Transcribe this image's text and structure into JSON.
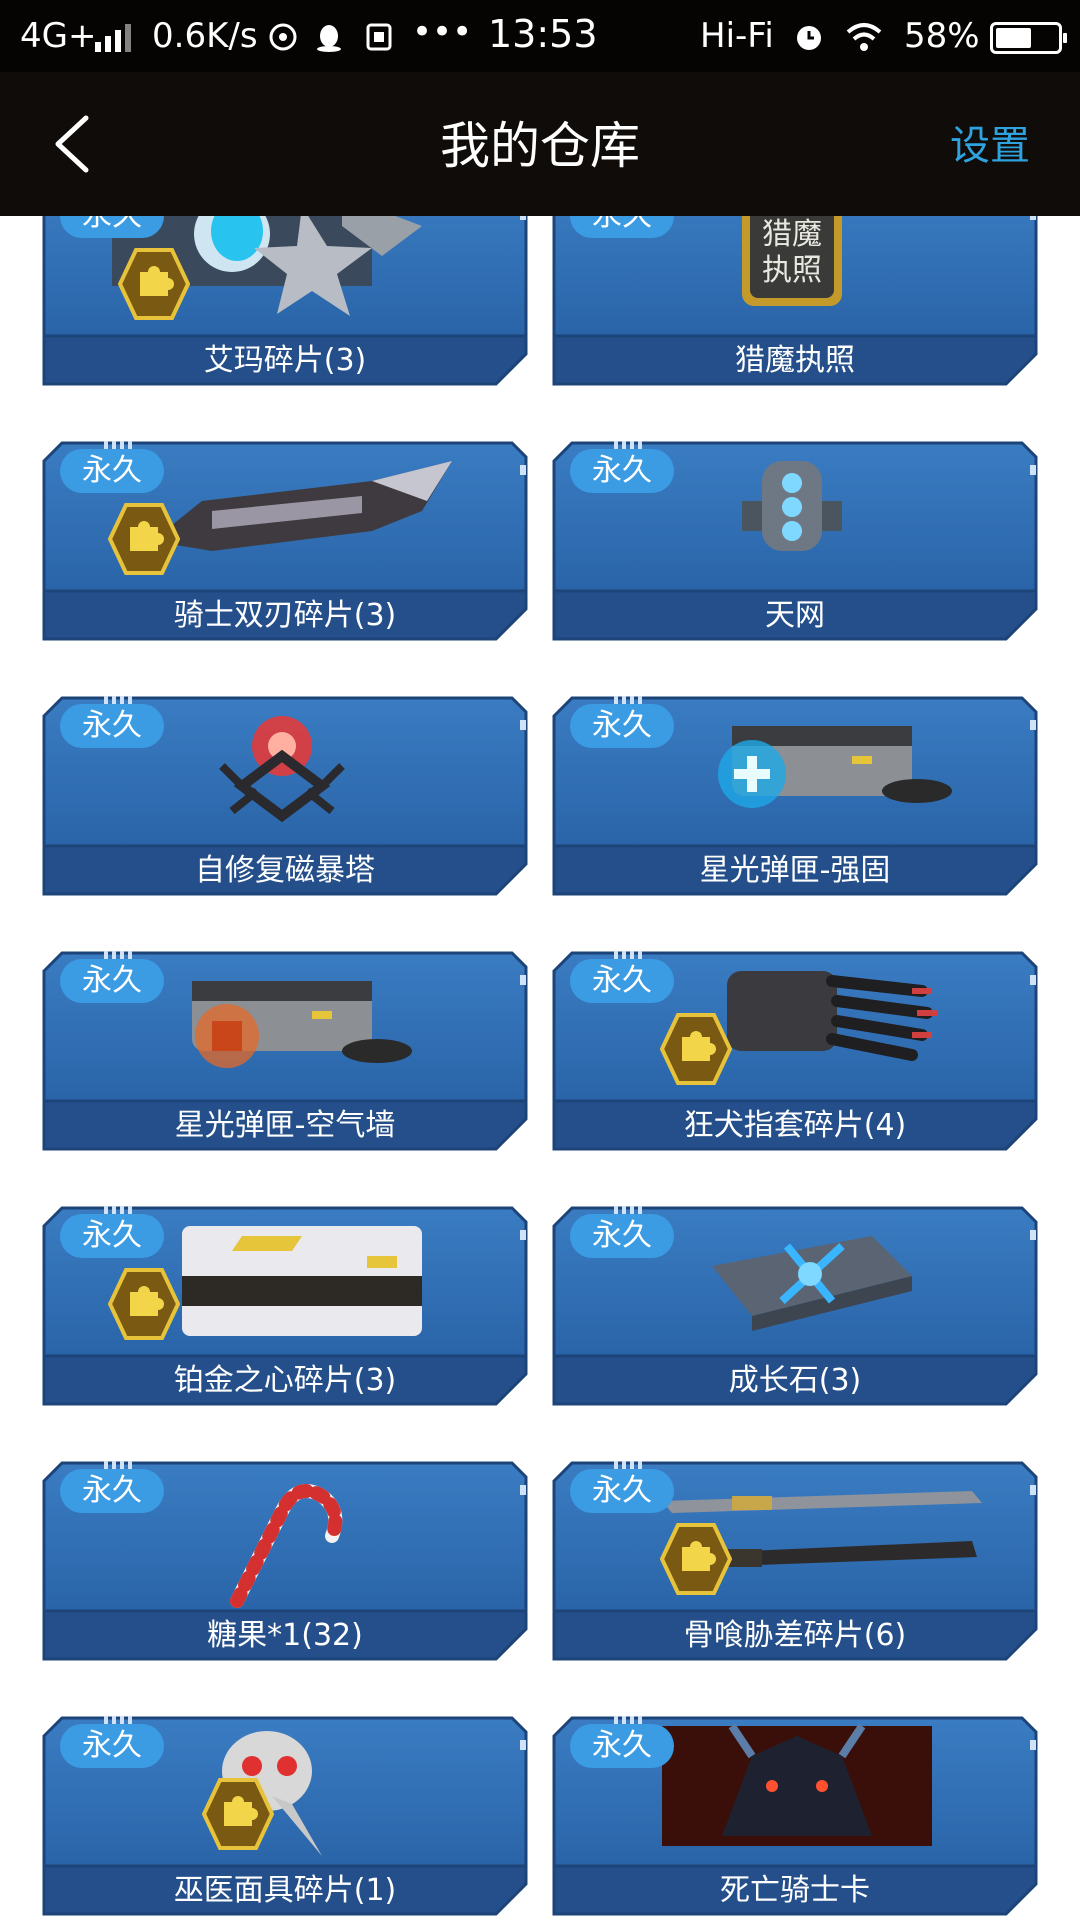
{
  "status_bar": {
    "network": "4G+",
    "speed": "0.6K/s",
    "time": "13:53",
    "hifi": "Hi-Fi",
    "battery": "58%",
    "battery_level": 0.58
  },
  "header": {
    "title": "我的仓库",
    "settings_label": "设置"
  },
  "colors": {
    "card_blue": "#2f6fb4",
    "card_dark": "#1f4d86",
    "badge": "#3b9be3",
    "accent": "#2ea3df"
  },
  "items": [
    {
      "name": "艾玛碎片(3)",
      "badge": "永久",
      "icon": "character-fragment-icon",
      "fragment": true
    },
    {
      "name": "猎魔执照",
      "badge": "永久",
      "icon": "license-icon",
      "license_text": [
        "猎魔",
        "执照"
      ],
      "fragment": false
    },
    {
      "name": "骑士双刃碎片(3)",
      "badge": "永久",
      "icon": "blade-icon",
      "fragment": true
    },
    {
      "name": "天网",
      "badge": "永久",
      "icon": "device-icon",
      "fragment": false
    },
    {
      "name": "自修复磁暴塔",
      "badge": "永久",
      "icon": "tesla-tower-icon",
      "fragment": false
    },
    {
      "name": "星光弹匣-强固",
      "badge": "永久",
      "icon": "magazine-plus-icon",
      "fragment": false
    },
    {
      "name": "星光弹匣-空气墙",
      "badge": "永久",
      "icon": "magazine-shield-icon",
      "fragment": false
    },
    {
      "name": "狂犬指套碎片(4)",
      "badge": "永久",
      "icon": "claw-icon",
      "fragment": true
    },
    {
      "name": "铂金之心碎片(3)",
      "badge": "永久",
      "icon": "weapon-case-icon",
      "fragment": true
    },
    {
      "name": "成长石(3)",
      "badge": "永久",
      "icon": "growth-stone-icon",
      "fragment": false
    },
    {
      "name": "糖果*1(32)",
      "badge": "永久",
      "icon": "candy-cane-icon",
      "fragment": false
    },
    {
      "name": "骨喰胁差碎片(6)",
      "badge": "永久",
      "icon": "katana-icon",
      "fragment": true
    },
    {
      "name": "巫医面具碎片(1)",
      "badge": "永久",
      "icon": "plague-mask-icon",
      "fragment": true
    },
    {
      "name": "死亡骑士卡",
      "badge": "永久",
      "icon": "death-knight-card-icon",
      "fragment": false
    }
  ]
}
